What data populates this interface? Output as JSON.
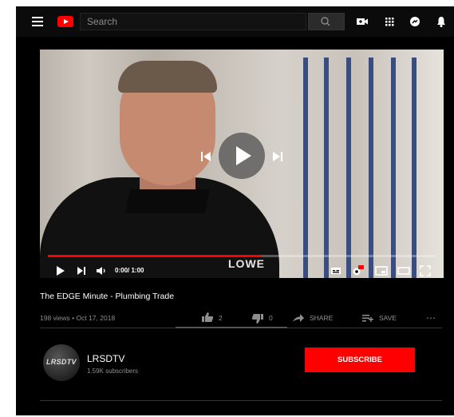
{
  "topbar": {
    "search_placeholder": "Search",
    "icons": [
      "menu-icon",
      "youtube-logo",
      "search-icon",
      "camera-icon",
      "apps-icon",
      "messages-icon",
      "bell-icon"
    ]
  },
  "player": {
    "time": "0:00/ 1:00",
    "progress_fraction": 0.55,
    "watermark": "LOWE",
    "accent": "#ff0000"
  },
  "video": {
    "title": "The EDGE Minute - Plumbing Trade",
    "meta": "198 views • Oct 17, 2018",
    "likes": "2",
    "dislikes": "0",
    "share_label": "SHARE",
    "save_label": "SAVE",
    "more_label": "⋯"
  },
  "channel": {
    "name": "LRSDTV",
    "subscribers": "1.59K subscribers",
    "avatar_text": "LRSDTV",
    "subscribe_label": "SUBSCRIBE"
  }
}
